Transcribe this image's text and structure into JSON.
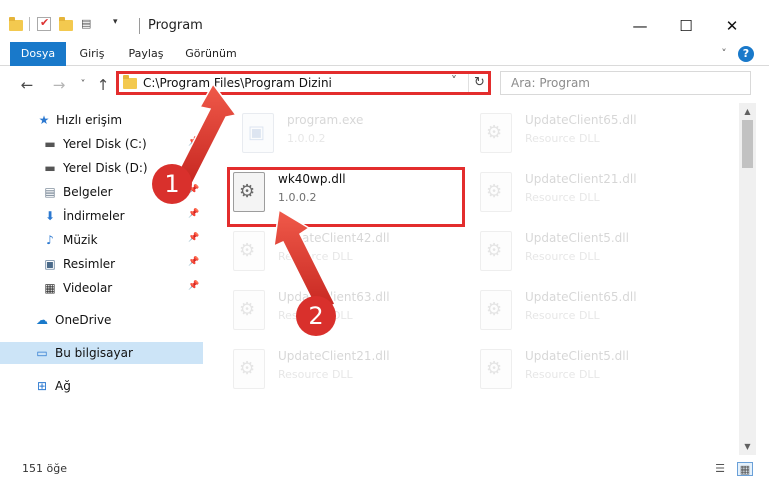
{
  "window": {
    "title": "Program",
    "minimize_glyph": "—",
    "maximize_glyph": "☐",
    "close_glyph": "✕"
  },
  "ribbon": {
    "tabs": [
      "Dosya",
      "Giriş",
      "Paylaş",
      "Görünüm"
    ],
    "active_tab": "Dosya",
    "expand_glyph": "˅",
    "help_glyph": "?"
  },
  "navigation": {
    "back_glyph": "←",
    "forward_glyph": "→",
    "recent_glyph": "˅",
    "up_glyph": "↑",
    "address": "C:\\Program Files\\Program Dizini",
    "address_dropdown_glyph": "˅",
    "refresh_glyph": "↻",
    "search_placeholder": "Ara: Program"
  },
  "sidebar": {
    "items": [
      {
        "label": "Hızlı erişim",
        "icon": "star-icon",
        "glyph": "★",
        "pinned": false
      },
      {
        "label": "Yerel Disk (C:)",
        "icon": "disk-c-icon",
        "glyph": "▬",
        "pinned": true
      },
      {
        "label": "Yerel Disk (D:)",
        "icon": "disk-d-icon",
        "glyph": "▬",
        "pinned": true
      },
      {
        "label": "Belgeler",
        "icon": "documents-icon",
        "glyph": "▤",
        "pinned": true
      },
      {
        "label": "İndirmeler",
        "icon": "downloads-icon",
        "glyph": "⬇",
        "pinned": true
      },
      {
        "label": "Müzik",
        "icon": "music-icon",
        "glyph": "♪",
        "pinned": true
      },
      {
        "label": "Resimler",
        "icon": "pictures-icon",
        "glyph": "▣",
        "pinned": true
      },
      {
        "label": "Videolar",
        "icon": "videos-icon",
        "glyph": "▦",
        "pinned": true
      },
      {
        "label": "OneDrive",
        "icon": "cloud-icon",
        "glyph": "☁",
        "pinned": false
      },
      {
        "label": "Bu bilgisayar",
        "icon": "computer-icon",
        "glyph": "▭",
        "pinned": false
      },
      {
        "label": "Ağ",
        "icon": "network-icon",
        "glyph": "⊞",
        "pinned": false
      }
    ],
    "pin_glyph": "📌",
    "selected_item": "Bu bilgisayar"
  },
  "files": [
    {
      "name": "program.exe",
      "sub": "1.0.0.2",
      "type": "exe"
    },
    {
      "name": "UpdateClient65.dll",
      "sub": "Resource DLL",
      "type": "dll"
    },
    {
      "name": "wk40wp.dll",
      "sub": "1.0.0.2",
      "type": "dll"
    },
    {
      "name": "UpdateClient21.dll",
      "sub": "Resource DLL",
      "type": "dll"
    },
    {
      "name": "UpdateClient42.dll",
      "sub": "Resource DLL",
      "type": "dll"
    },
    {
      "name": "UpdateClient5.dll",
      "sub": "Resource DLL",
      "type": "dll"
    },
    {
      "name": "UpdateClient63.dll",
      "sub": "Resource DLL",
      "type": "dll"
    },
    {
      "name": "UpdateClient65.dll",
      "sub": "Resource DLL",
      "type": "dll"
    },
    {
      "name": "UpdateClient21.dll",
      "sub": "Resource DLL",
      "type": "dll"
    },
    {
      "name": "UpdateClient5.dll",
      "sub": "Resource DLL",
      "type": "dll"
    }
  ],
  "highlighted_file": "wk40wp.dll",
  "statusbar": {
    "item_count": "151 öğe",
    "details_view_glyph": "☰",
    "icons_view_glyph": "▦"
  },
  "scrollbar": {
    "up_glyph": "▲",
    "down_glyph": "▼"
  },
  "annotations": {
    "callout_1": "1",
    "callout_2": "2",
    "accent_color": "#e32d2d"
  },
  "colors": {
    "ribbon_active": "#1979ca",
    "selection": "#cce4f7"
  }
}
